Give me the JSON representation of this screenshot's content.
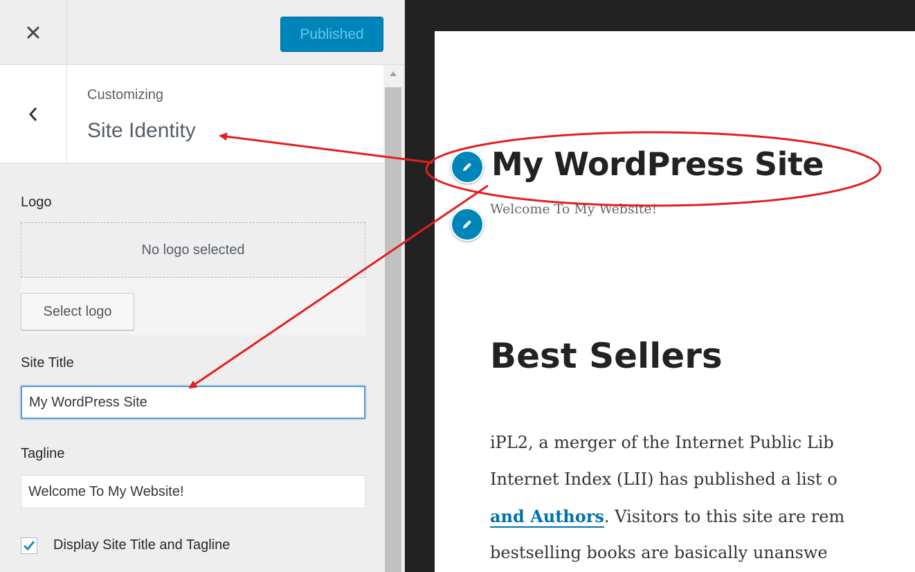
{
  "customizer": {
    "publish_label": "Published",
    "breadcrumb": "Customizing",
    "section_title": "Site Identity",
    "logo": {
      "label": "Logo",
      "empty_text": "No logo selected",
      "select_button": "Select logo"
    },
    "site_title": {
      "label": "Site Title",
      "value": "My WordPress Site"
    },
    "tagline": {
      "label": "Tagline",
      "value": "Welcome To My Website!"
    },
    "display_title_tagline": {
      "label": "Display Site Title and Tagline",
      "checked": true
    }
  },
  "preview": {
    "site_title": "My WordPress Site",
    "tagline": "Welcome To My Website!",
    "heading": "Best Sellers",
    "body_lines": [
      "iPL2, a merger of the Internet Public Lib",
      "Internet Index (LII) has published a list o",
      "bestselling books are basically unanswe"
    ],
    "link_text": "and Authors",
    "line3_after_link": ". Visitors to this site are rem"
  },
  "colors": {
    "accent": "#0085ba",
    "annotation": "#e41e1e"
  }
}
